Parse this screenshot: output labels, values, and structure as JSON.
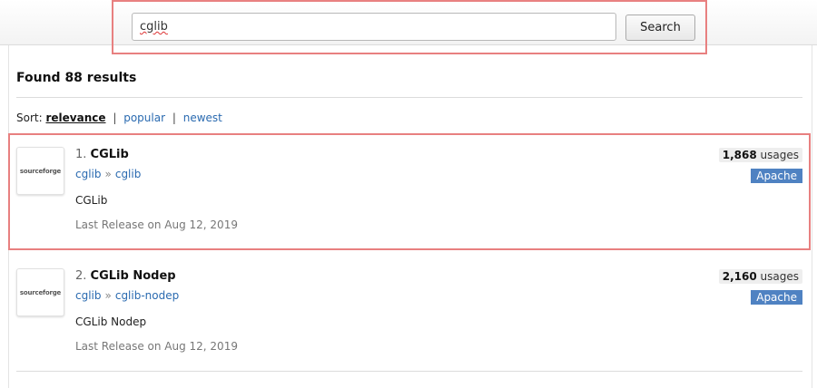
{
  "search": {
    "value": "cglib",
    "button_label": "Search"
  },
  "summary": {
    "found_text": "Found 88 results"
  },
  "sort": {
    "label": "Sort:",
    "options": [
      "relevance",
      "popular",
      "newest"
    ],
    "separator": "|",
    "active": "relevance"
  },
  "results": [
    {
      "index": "1.",
      "name": "CGLib",
      "logo_text": "sourceforge",
      "group": "cglib",
      "artifact": "cglib",
      "arrow": "»",
      "description": "CGLib",
      "release": "Last Release on Aug 12, 2019",
      "usage_count": "1,868",
      "usage_label": "usages",
      "license": "Apache"
    },
    {
      "index": "2.",
      "name": "CGLib Nodep",
      "logo_text": "sourceforge",
      "group": "cglib",
      "artifact": "cglib-nodep",
      "arrow": "»",
      "description": "CGLib Nodep",
      "release": "Last Release on Aug 12, 2019",
      "usage_count": "2,160",
      "usage_label": "usages",
      "license": "Apache"
    }
  ],
  "colors": {
    "accent_link": "#2a6ab0",
    "license_badge": "#4f82c2",
    "highlight_box": "#e88080"
  }
}
